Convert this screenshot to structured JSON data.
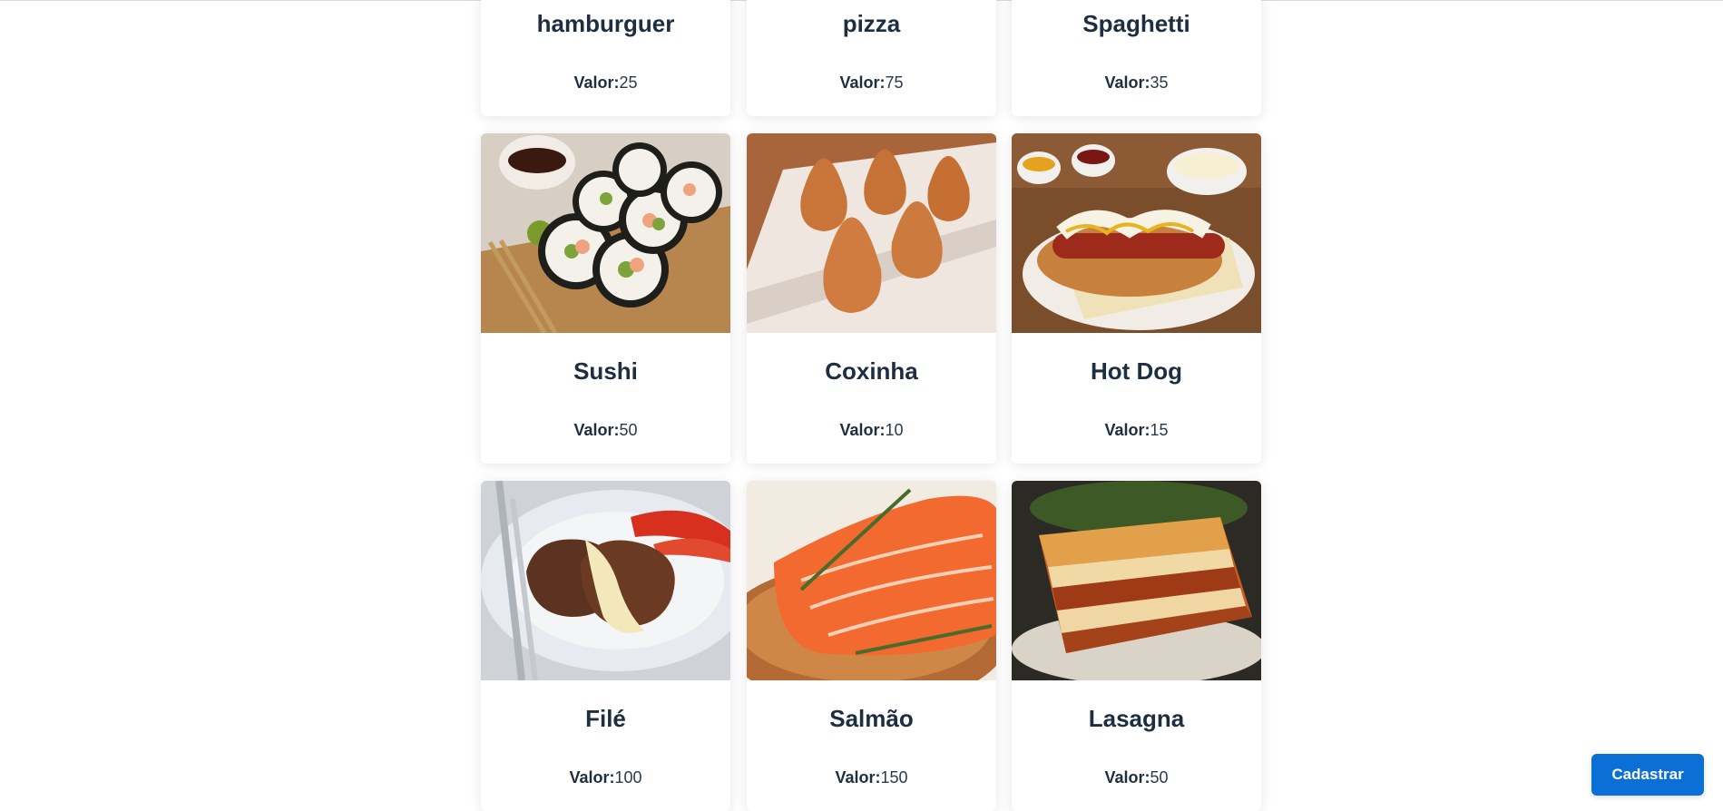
{
  "products": [
    {
      "name": "hamburguer",
      "price_label": "Valor:",
      "price": "25"
    },
    {
      "name": "pizza",
      "price_label": "Valor:",
      "price": "75"
    },
    {
      "name": "Spaghetti",
      "price_label": "Valor:",
      "price": "35"
    },
    {
      "name": "Sushi",
      "price_label": "Valor:",
      "price": "50"
    },
    {
      "name": "Coxinha",
      "price_label": "Valor:",
      "price": "10"
    },
    {
      "name": "Hot Dog",
      "price_label": "Valor:",
      "price": "15"
    },
    {
      "name": "Filé",
      "price_label": "Valor:",
      "price": "100"
    },
    {
      "name": "Salmão",
      "price_label": "Valor:",
      "price": "150"
    },
    {
      "name": "Lasagna",
      "price_label": "Valor:",
      "price": "50"
    }
  ],
  "actions": {
    "register_label": "Cadastrar"
  },
  "colors": {
    "primary": "#0b6fd6",
    "heading": "#1c2e40",
    "background": "#ffffff"
  }
}
